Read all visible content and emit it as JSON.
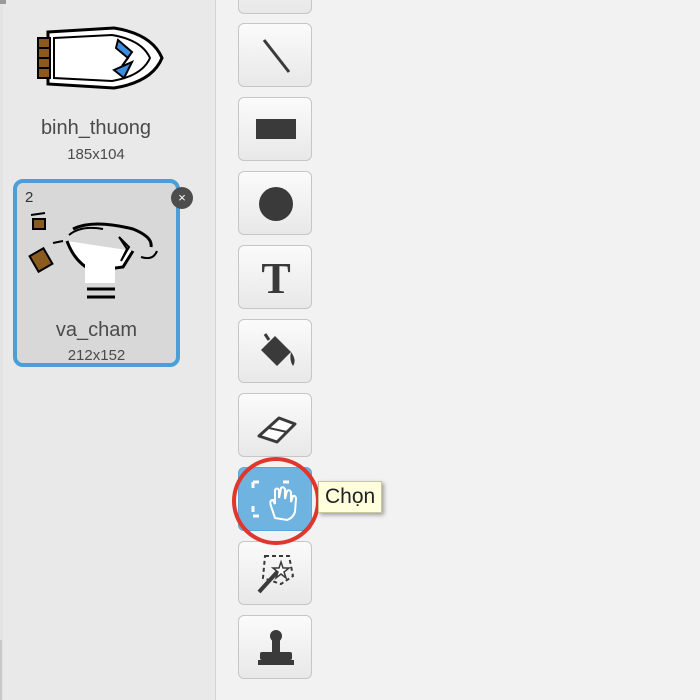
{
  "costumes": [
    {
      "index": "",
      "name": "binh_thuong",
      "size": "185x104"
    },
    {
      "index": "2",
      "name": "va_cham",
      "size": "212x152",
      "selected": true
    }
  ],
  "delete_icon": "×",
  "tools": [
    {
      "name": "line-tool",
      "icon": "line-icon"
    },
    {
      "name": "rectangle-tool",
      "icon": "rectangle-icon"
    },
    {
      "name": "ellipse-tool",
      "icon": "circle-icon"
    },
    {
      "name": "text-tool",
      "icon": "text-icon",
      "glyph": "T"
    },
    {
      "name": "fill-tool",
      "icon": "paint-bucket-icon"
    },
    {
      "name": "eraser-tool",
      "icon": "eraser-icon"
    },
    {
      "name": "select-tool",
      "icon": "select-hand-icon",
      "selected": true
    },
    {
      "name": "magic-select-tool",
      "icon": "magic-wand-icon"
    },
    {
      "name": "stamp-tool",
      "icon": "stamp-icon"
    }
  ],
  "tooltip": {
    "text": "Chọn"
  },
  "colors": {
    "accent": "#4a9fd9",
    "selected_tool": "#6fb3e0",
    "highlight": "#e0362b"
  }
}
